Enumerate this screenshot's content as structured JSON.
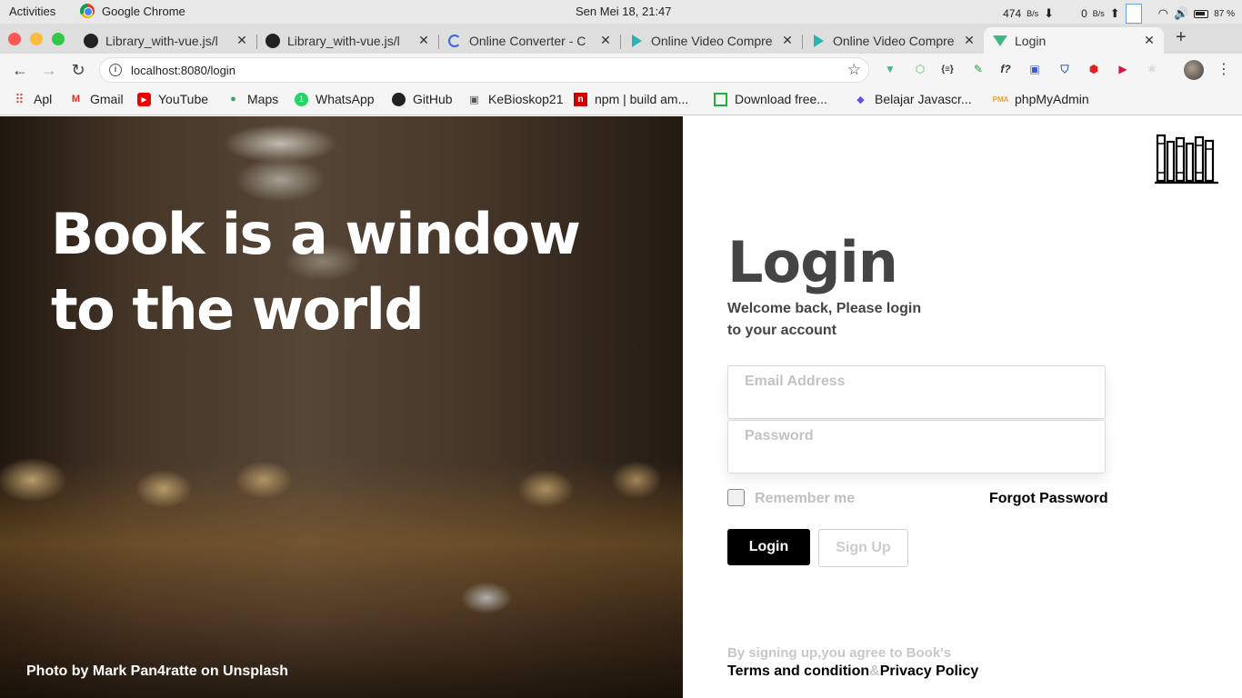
{
  "system_bar": {
    "activities": "Activities",
    "app_name": "Google Chrome",
    "clock": "Sen Mei 18, 21:47",
    "net_down": "474",
    "net_down_unit": "B/s",
    "net_up": "0",
    "net_up_unit": "B/s",
    "battery": "87 %"
  },
  "tabs": [
    {
      "title": "Library_with-vue.js/l",
      "icon": "github-icon"
    },
    {
      "title": "Library_with-vue.js/l",
      "icon": "github-icon"
    },
    {
      "title": "Online Converter - C",
      "icon": "converter-icon"
    },
    {
      "title": "Online Video Compre",
      "icon": "play-icon"
    },
    {
      "title": "Online Video Compre",
      "icon": "play-icon"
    },
    {
      "title": "Login",
      "icon": "vue-icon",
      "active": true
    }
  ],
  "toolbar": {
    "url": "localhost:8080/login"
  },
  "bookmarks": [
    {
      "label": "Apl",
      "icon": "apps-grid-icon"
    },
    {
      "label": "Gmail",
      "icon": "gmail-icon"
    },
    {
      "label": "YouTube",
      "icon": "youtube-icon"
    },
    {
      "label": "Maps",
      "icon": "maps-icon"
    },
    {
      "label": "WhatsApp",
      "icon": "whatsapp-icon"
    },
    {
      "label": "GitHub",
      "icon": "github-icon"
    },
    {
      "label": "KeBioskop21",
      "icon": "tv-icon"
    },
    {
      "label": "npm | build am...",
      "icon": "npm-icon"
    },
    {
      "label": "Download free...",
      "icon": "download-icon"
    },
    {
      "label": "Belajar Javascr...",
      "icon": "code-icon"
    },
    {
      "label": "phpMyAdmin",
      "icon": "phpmyadmin-icon"
    }
  ],
  "hero": {
    "title_line1": "Book is a window",
    "title_line2": "to the world",
    "credit": "Photo by Mark Pan4ratte on Unsplash"
  },
  "login": {
    "title": "Login",
    "welcome_line1": "Welcome back, Please login",
    "welcome_line2": "to your account",
    "email_placeholder": "Email Address",
    "password_placeholder": "Password",
    "remember_label": "Remember me",
    "forgot_label": "Forgot Password",
    "login_button": "Login",
    "signup_button": "Sign Up",
    "agree_text": "By signing up,you agree to Book's",
    "terms_link": "Terms and condition",
    "amp": "&",
    "privacy_link": "Privacy Policy"
  },
  "colors": {
    "primary_button": "#000000",
    "heading": "#444444",
    "muted_text": "#c8c8c8",
    "vue_green": "#41b883"
  }
}
